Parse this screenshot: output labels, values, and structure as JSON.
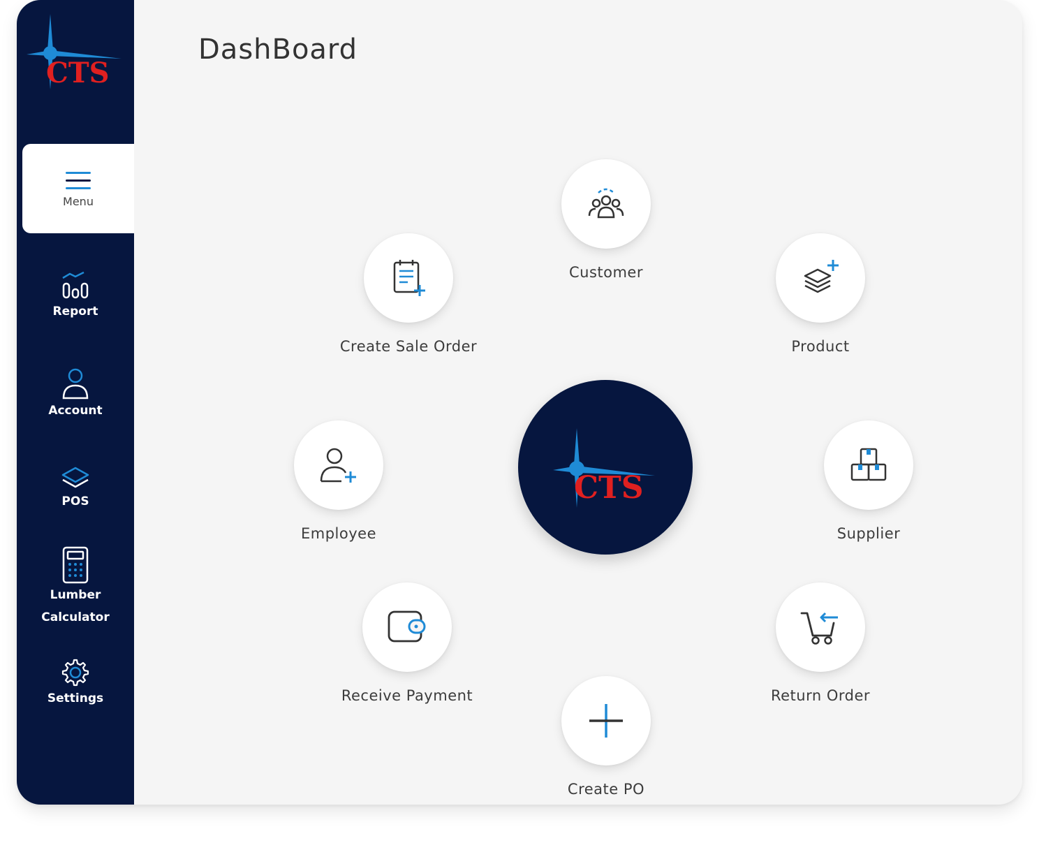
{
  "app": {
    "brand_text": "CTS",
    "page_title": "DashBoard"
  },
  "colors": {
    "sidebar": "#06163f",
    "accent": "#1f8bd6",
    "brand_red": "#e02020",
    "background": "#f5f5f5"
  },
  "sidebar": {
    "menu": {
      "label": "Menu",
      "icon": "hamburger-icon"
    },
    "items": [
      {
        "label": "Report",
        "icon": "chart-icon"
      },
      {
        "label": "Account",
        "icon": "user-icon"
      },
      {
        "label": "POS",
        "icon": "layers-icon"
      },
      {
        "label_line1": "Lumber",
        "label_line2": "Calculator",
        "icon": "calculator-icon"
      },
      {
        "label": "Settings",
        "icon": "gear-icon"
      }
    ]
  },
  "actions": {
    "customer": {
      "label": "Customer",
      "icon": "customers-icon"
    },
    "create_sale_order": {
      "label": "Create Sale Order",
      "icon": "clipboard-plus-icon"
    },
    "product": {
      "label": "Product",
      "icon": "layers-plus-icon"
    },
    "employee": {
      "label": "Employee",
      "icon": "add-user-icon"
    },
    "supplier": {
      "label": "Supplier",
      "icon": "boxes-icon"
    },
    "receive_payment": {
      "label": "Receive Payment",
      "icon": "wallet-icon"
    },
    "return_order": {
      "label": "Return Order",
      "icon": "cart-return-icon"
    },
    "create_po": {
      "label": "Create PO",
      "icon": "plus-icon"
    }
  }
}
